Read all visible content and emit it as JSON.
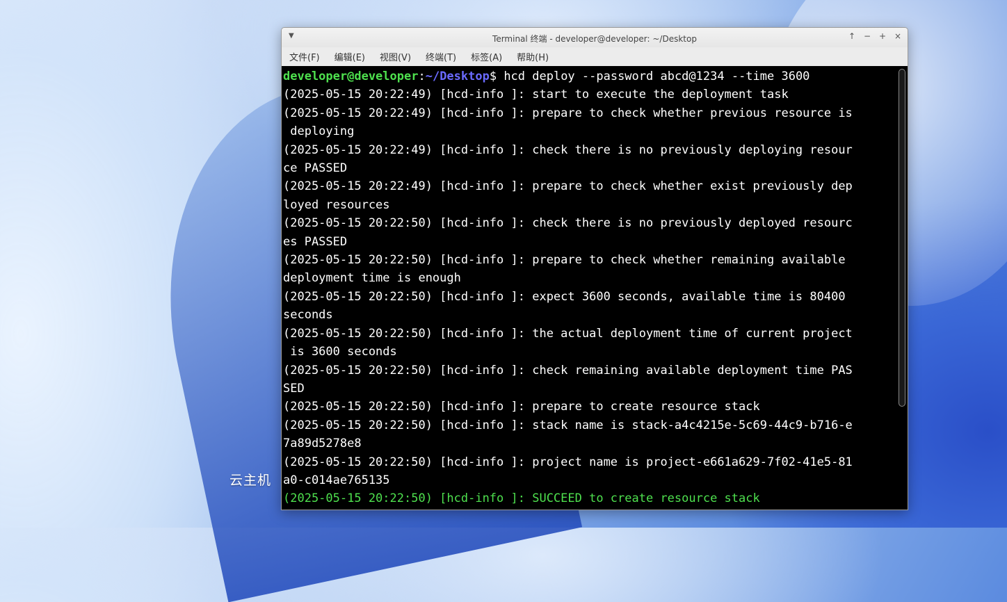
{
  "desktop": {
    "label": "云主机"
  },
  "window": {
    "title": "Terminal 终端 - developer@developer: ~/Desktop",
    "menu_icon": "chevron-down-icon",
    "controls": [
      "↑",
      "−",
      "+",
      "×"
    ],
    "menu": [
      "文件(F)",
      "编辑(E)",
      "视图(V)",
      "终端(T)",
      "标签(A)",
      "帮助(H)"
    ]
  },
  "terminal": {
    "prompt_user": "developer@developer",
    "prompt_sep": ":",
    "prompt_path": "~/Desktop",
    "prompt_tail": "$ hcd deploy --password abcd@1234 --time 3600",
    "lines": [
      "(2025-05-15 20:22:49) [hcd-info ]: start to execute the deployment task",
      "(2025-05-15 20:22:49) [hcd-info ]: prepare to check whether previous resource is",
      " deploying",
      "(2025-05-15 20:22:49) [hcd-info ]: check there is no previously deploying resour",
      "ce PASSED",
      "(2025-05-15 20:22:49) [hcd-info ]: prepare to check whether exist previously dep",
      "loyed resources",
      "(2025-05-15 20:22:50) [hcd-info ]: check there is no previously deployed resourc",
      "es PASSED",
      "(2025-05-15 20:22:50) [hcd-info ]: prepare to check whether remaining available",
      "deployment time is enough",
      "(2025-05-15 20:22:50) [hcd-info ]: expect 3600 seconds, available time is 80400",
      "seconds",
      "(2025-05-15 20:22:50) [hcd-info ]: the actual deployment time of current project",
      " is 3600 seconds",
      "(2025-05-15 20:22:50) [hcd-info ]: check remaining available deployment time PAS",
      "SED",
      "(2025-05-15 20:22:50) [hcd-info ]: prepare to create resource stack",
      "(2025-05-15 20:22:50) [hcd-info ]: stack name is stack-a4c4215e-5c69-44c9-b716-e",
      "7a89d5278e8",
      "(2025-05-15 20:22:50) [hcd-info ]: project name is project-e661a629-7f02-41e5-81",
      "a0-c014ae765135"
    ],
    "success_line": "(2025-05-15 20:22:50) [hcd-info ]: SUCCEED to create resource stack",
    "colors": {
      "user": "#4ee04e",
      "path": "#6a6aff",
      "success": "#4ee04e",
      "background": "#000000"
    }
  }
}
